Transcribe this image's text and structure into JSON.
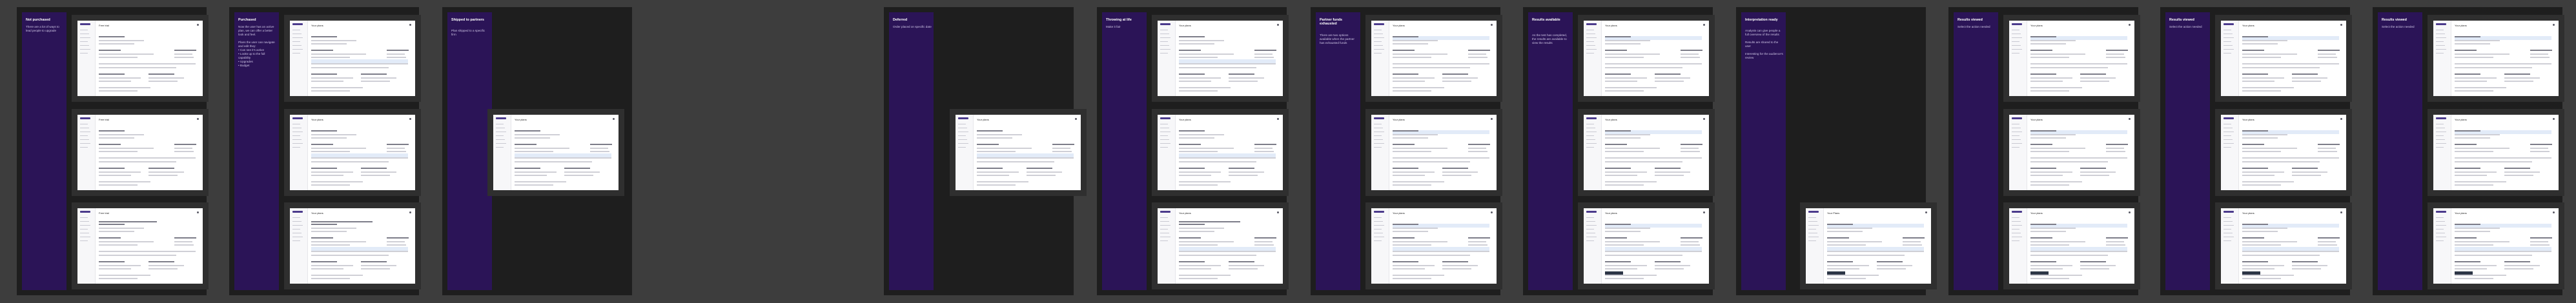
{
  "boards": [
    {
      "title": "Not purchased",
      "desc": "There are a lot of ways to lead people to upgrade",
      "frames": [
        {
          "row": 0,
          "title": "Free trial",
          "variant": "a"
        },
        {
          "row": 1,
          "title": "Free trial",
          "variant": "a"
        },
        {
          "row": 2,
          "title": "Free trial",
          "variant": "b"
        }
      ]
    },
    {
      "title": "Purchased",
      "desc": "Now the user has an active plan, we can offer a better look and feel.\n\nPlans the user can navigate and edit they:\n•  Can see it's active\n•  Looks up to the full capability\n•  Upgrades\n•  Budget",
      "frames": [
        {
          "row": 0,
          "title": "Your plans",
          "variant": "c"
        },
        {
          "row": 1,
          "title": "Your plans",
          "variant": "c"
        },
        {
          "row": 2,
          "title": "Your plans",
          "variant": "d"
        }
      ]
    },
    {
      "title": "Shipped to partners",
      "desc": "Plan shipped to a specific firm",
      "frames": [
        {
          "row": 1,
          "title": "Your plans",
          "variant": "c"
        }
      ]
    },
    {
      "title": "Deferred",
      "desc": "Order placed on specific date",
      "frames": [
        {
          "row": 1,
          "title": "Your plans",
          "variant": "c"
        }
      ]
    },
    {
      "title": "Throwing at life",
      "desc": "Make it fair",
      "frames": [
        {
          "row": 0,
          "title": "Your plans",
          "variant": "c"
        },
        {
          "row": 1,
          "title": "Your plans",
          "variant": "c"
        },
        {
          "row": 2,
          "title": "Your plans",
          "variant": "d"
        }
      ]
    },
    {
      "title": "Partner funds exhausted",
      "desc": "There are two options available when the partner has exhausted funds",
      "frames": [
        {
          "row": 0,
          "title": "Your plans",
          "variant": "e"
        },
        {
          "row": 1,
          "title": "Your plans",
          "variant": "e"
        },
        {
          "row": 2,
          "title": "Your plans",
          "variant": "f"
        }
      ]
    },
    {
      "title": "Results available",
      "desc": "As the test has completed, the results are available to view the results",
      "frames": [
        {
          "row": 0,
          "title": "Your plans",
          "variant": "g"
        },
        {
          "row": 1,
          "title": "Your plans",
          "variant": "g"
        },
        {
          "row": 2,
          "title": "Your plans",
          "variant": "h"
        }
      ]
    },
    {
      "title": "Interpretation ready",
      "desc": "Analysis can give people a full overview of the results\n\nResults are shared to the user\n\nInteresting for the audience's review",
      "frames": [
        {
          "row": 2,
          "title": "Your Plans",
          "variant": "h"
        }
      ]
    },
    {
      "title": "Results viewed",
      "desc": "Select the action needed",
      "frames": [
        {
          "row": 0,
          "title": "Your plans",
          "variant": "g"
        },
        {
          "row": 1,
          "title": "Your plans",
          "variant": "g"
        },
        {
          "row": 2,
          "title": "Your plans",
          "variant": "h"
        }
      ]
    },
    {
      "title": "Results viewed",
      "desc": "Select the action needed",
      "frames": [
        {
          "row": 0,
          "title": "Your plans",
          "variant": "g"
        },
        {
          "row": 1,
          "title": "Your plans",
          "variant": "g"
        },
        {
          "row": 2,
          "title": "Your plans",
          "variant": "h"
        }
      ]
    },
    {
      "title": "Results viewed",
      "desc": "Select the action needed",
      "frames": [
        {
          "row": 0,
          "title": "Your plans",
          "variant": "g"
        },
        {
          "row": 1,
          "title": "Your plans",
          "variant": "g"
        },
        {
          "row": 2,
          "title": "Your plans",
          "variant": "h"
        }
      ]
    }
  ]
}
